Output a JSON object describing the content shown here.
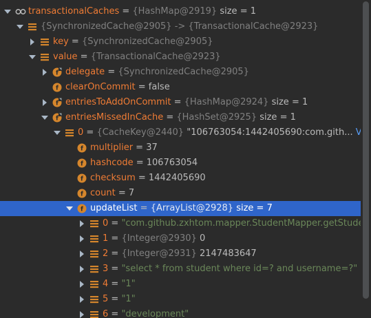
{
  "rows": [
    {
      "indent": 0,
      "arrow": "down",
      "icon": "watch",
      "name": "transactionalCaches",
      "eq": " = ",
      "ref": "{HashMap@2919}",
      "suffix": "  size = 1"
    },
    {
      "indent": 1,
      "arrow": "down",
      "icon": "field-list",
      "name": "",
      "eq": "",
      "ref": "{SynchronizedCache@2905}  -> {TransactionalCache@2923}",
      "suffix": ""
    },
    {
      "indent": 2,
      "arrow": "right",
      "icon": "field-list",
      "name": "key",
      "eq": " = ",
      "ref": "{SynchronizedCache@2905}",
      "suffix": ""
    },
    {
      "indent": 2,
      "arrow": "down",
      "icon": "field-list",
      "name": "value",
      "eq": " = ",
      "ref": "{TransactionalCache@2923}",
      "suffix": ""
    },
    {
      "indent": 3,
      "arrow": "right",
      "icon": "field-f-locked",
      "name": "delegate",
      "eq": " = ",
      "ref": "{SynchronizedCache@2905}",
      "suffix": ""
    },
    {
      "indent": 3,
      "arrow": "none",
      "icon": "field-f",
      "name": "clearOnCommit",
      "eq": " = ",
      "ref": "",
      "suffix": "false"
    },
    {
      "indent": 3,
      "arrow": "right",
      "icon": "field-f-locked",
      "name": "entriesToAddOnCommit",
      "eq": " = ",
      "ref": "{HashMap@2924}",
      "suffix": "  size = 1"
    },
    {
      "indent": 3,
      "arrow": "down",
      "icon": "field-f-locked",
      "name": "entriesMissedInCache",
      "eq": " = ",
      "ref": "{HashSet@2925}",
      "suffix": "  size = 1"
    },
    {
      "indent": 4,
      "arrow": "down",
      "icon": "field-list",
      "name": "0",
      "eq": " = ",
      "ref": "{CacheKey@2440}",
      "suffix": " \"106763054:1442405690:com.gith...",
      "link": "View"
    },
    {
      "indent": 5,
      "arrow": "none",
      "icon": "field-f",
      "name": "multiplier",
      "eq": " = ",
      "ref": "",
      "suffix": "37"
    },
    {
      "indent": 5,
      "arrow": "none",
      "icon": "field-f",
      "name": "hashcode",
      "eq": " = ",
      "ref": "",
      "suffix": "106763054"
    },
    {
      "indent": 5,
      "arrow": "none",
      "icon": "field-f",
      "name": "checksum",
      "eq": " = ",
      "ref": "",
      "suffix": "1442405690"
    },
    {
      "indent": 5,
      "arrow": "none",
      "icon": "field-f",
      "name": "count",
      "eq": " = ",
      "ref": "",
      "suffix": "7"
    },
    {
      "indent": 5,
      "arrow": "down",
      "icon": "field-f",
      "name": "updateList",
      "eq": " = ",
      "ref": "{ArrayList@2928}",
      "suffix": "  size = 7",
      "selected": true
    },
    {
      "indent": 6,
      "arrow": "right",
      "icon": "field-list",
      "name": "0",
      "eq": " = ",
      "ref": "",
      "str": "\"com.github.zxhtom.mapper.StudentMapper.getStude"
    },
    {
      "indent": 6,
      "arrow": "right",
      "icon": "field-list",
      "name": "1",
      "eq": " = ",
      "ref": "{Integer@2930}",
      "suffix": " 0"
    },
    {
      "indent": 6,
      "arrow": "right",
      "icon": "field-list",
      "name": "2",
      "eq": " = ",
      "ref": "{Integer@2931}",
      "suffix": " 2147483647"
    },
    {
      "indent": 6,
      "arrow": "right",
      "icon": "field-list",
      "name": "3",
      "eq": " = ",
      "ref": "",
      "str": "\"select * from student where id=? and username=?\""
    },
    {
      "indent": 6,
      "arrow": "right",
      "icon": "field-list",
      "name": "4",
      "eq": " = ",
      "ref": "",
      "str": "\"1\""
    },
    {
      "indent": 6,
      "arrow": "right",
      "icon": "field-list",
      "name": "5",
      "eq": " = ",
      "ref": "",
      "str": "\"1\""
    },
    {
      "indent": 6,
      "arrow": "right",
      "icon": "field-list",
      "name": "6",
      "eq": " = ",
      "ref": "",
      "str": "\"development\""
    }
  ],
  "colors": {
    "background": "#2b2b2b",
    "selection": "#2f65ca",
    "field_name": "#ef7c35",
    "reference": "#808080",
    "string": "#6a8759",
    "link": "#589df6",
    "icon_orange": "#d5862c"
  }
}
